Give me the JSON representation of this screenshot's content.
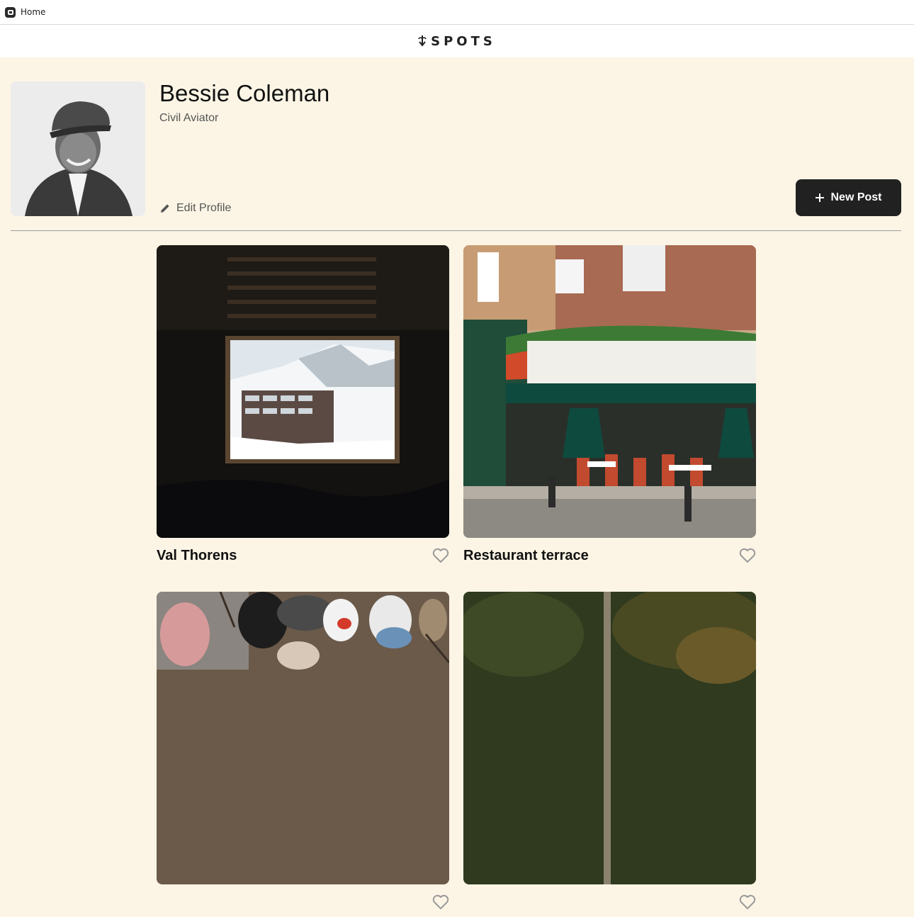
{
  "window": {
    "title": "Home"
  },
  "header": {
    "logo_text": "SPOTS"
  },
  "profile": {
    "name": "Bessie Coleman",
    "description": "Civil Aviator",
    "edit_label": "Edit Profile",
    "new_post_label": "New Post"
  },
  "cards": [
    {
      "title": "Val Thorens",
      "liked": false
    },
    {
      "title": "Restaurant terrace",
      "liked": false
    },
    {
      "title": "",
      "liked": false
    },
    {
      "title": "",
      "liked": false
    }
  ],
  "icons": {
    "logo": "sprout-arrow-icon",
    "edit": "pencil-icon",
    "new_post": "plus-icon",
    "like": "heart-outline-icon"
  },
  "colors": {
    "page_background": "#fcf5e5",
    "primary_dark": "#212121",
    "secondary_text": "#555555"
  }
}
